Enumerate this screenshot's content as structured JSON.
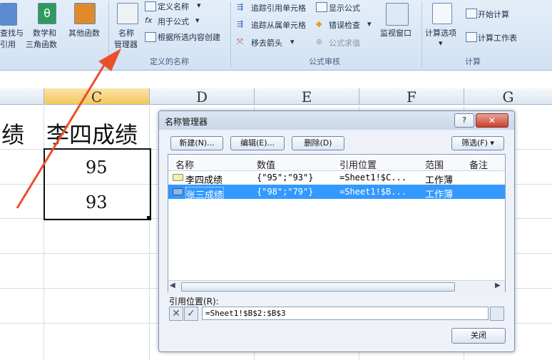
{
  "ribbon": {
    "lookup_label_1": "查找与",
    "lookup_label_2": "引用",
    "math_label_1": "数学和",
    "math_label_2": "三角函数",
    "other_label": "其他函数",
    "name_manager_label_1": "名称",
    "name_manager_label_2": "管理器",
    "define_name": "定义名称",
    "use_in_formula": "用于公式",
    "create_from_selection": "根据所选内容创建",
    "defined_names_group": "定义的名称",
    "trace_precedents": "追踪引用单元格",
    "trace_dependents": "追踪从属单元格",
    "remove_arrows": "移去箭头",
    "show_formulas": "显示公式",
    "error_checking": "错误检查",
    "evaluate_formula": "公式求值",
    "formula_audit_group": "公式审核",
    "watch_window": "监视窗口",
    "calc_options": "计算选项",
    "calc_now": "开始计算",
    "calc_sheet": "计算工作表",
    "calc_group": "计算"
  },
  "sheet": {
    "columns": [
      "C",
      "D",
      "E",
      "F",
      "G"
    ],
    "cell_b1": "绩",
    "cell_c1": "李四成绩",
    "cell_c2": "95",
    "cell_c3": "93"
  },
  "dialog": {
    "title": "名称管理器",
    "help": "?",
    "close_x": "✕",
    "new_btn": "新建(N)...",
    "edit_btn": "编辑(E)...",
    "delete_btn": "删除(D)",
    "filter_btn": "筛选(F)",
    "headers": [
      "名称",
      "数值",
      "引用位置",
      "范围",
      "备注"
    ],
    "rows": [
      {
        "name": "李四成绩",
        "value": "{\"95\";\"93\"}",
        "ref": "=Sheet1!$C...",
        "scope": "工作薄"
      },
      {
        "name": "张三成绩",
        "value": "{\"98\";\"79\"}",
        "ref": "=Sheet1!$B...",
        "scope": "工作薄"
      }
    ],
    "refers_to_label": "引用位置(R):",
    "refers_to_value": "=Sheet1!$B$2:$B$3",
    "close_btn": "关闭"
  },
  "colors": {
    "arrow": "#e8502c",
    "selection": "#3399ff",
    "tab_green": "#1f8a52"
  }
}
